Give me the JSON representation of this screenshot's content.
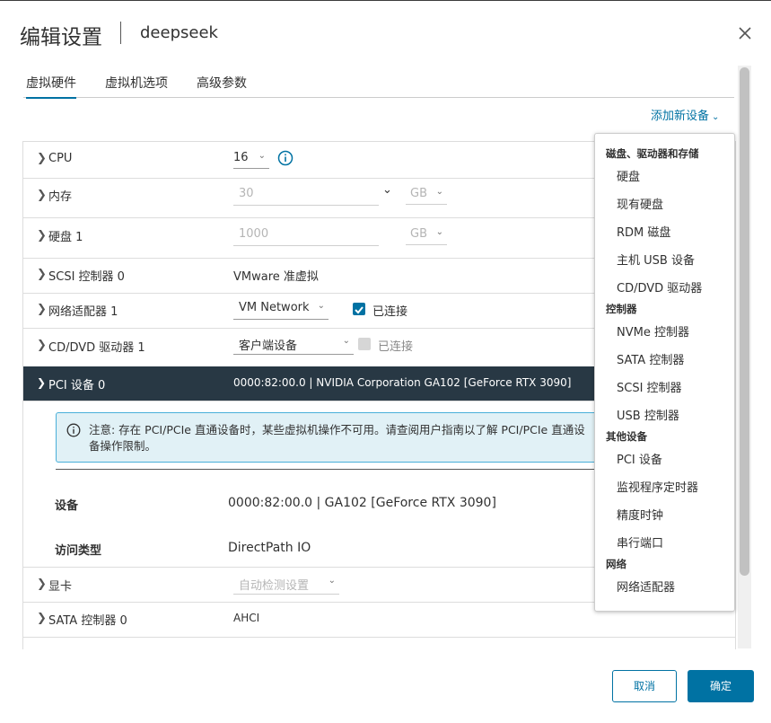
{
  "dialog": {
    "title": "编辑设置",
    "vm_name": "deepseek"
  },
  "tabs": [
    {
      "label": "虚拟硬件",
      "active": true
    },
    {
      "label": "虚拟机选项",
      "active": false
    },
    {
      "label": "高级参数",
      "active": false
    }
  ],
  "add_device": {
    "label": "添加新设备",
    "icon": "chevron-down-icon"
  },
  "hardware": {
    "cpu": {
      "label": "CPU",
      "value": "16"
    },
    "memory": {
      "label": "内存",
      "value": "30",
      "unit": "GB"
    },
    "disk": {
      "label": "硬盘 1",
      "value": "1000",
      "unit": "GB"
    },
    "scsi": {
      "label": "SCSI 控制器 0",
      "value": "VMware 准虚拟"
    },
    "nic": {
      "label": "网络适配器 1",
      "value": "VM Network",
      "connected_label": "已连接",
      "connected": true
    },
    "cdrom": {
      "label": "CD/DVD 驱动器 1",
      "value": "客户端设备",
      "connected_label": "已连接",
      "connected": false
    },
    "pci": {
      "label": "PCI 设备 0",
      "value": "0000:82:00.0 | NVIDIA Corporation GA102 [GeForce RTX 3090]",
      "alert_text": "注意: 存在 PCI/PCIe 直通设备时，某些虚拟机操作不可用。请查阅用户指南以了解 PCI/PCIe 直通设备操作限制。",
      "device_label": "设备",
      "device_value": "0000:82:00.0 | GA102 [GeForce RTX 3090]",
      "access_label": "访问类型",
      "access_value": "DirectPath IO"
    },
    "video": {
      "label": "显卡",
      "value": "自动检测设置"
    },
    "sata": {
      "label": "SATA 控制器 0",
      "value": "AHCI"
    }
  },
  "add_menu": {
    "sections": [
      {
        "title": "磁盘、驱动器和存储",
        "items": [
          "硬盘",
          "现有硬盘",
          "RDM 磁盘",
          "主机 USB 设备",
          "CD/DVD 驱动器"
        ]
      },
      {
        "title": "控制器",
        "items": [
          "NVMe 控制器",
          "SATA 控制器",
          "SCSI 控制器",
          "USB 控制器"
        ]
      },
      {
        "title": "其他设备",
        "items": [
          "PCI 设备",
          "监视程序定时器",
          "精度时钟",
          "串行端口"
        ]
      },
      {
        "title": "网络",
        "items": [
          "网络适配器"
        ]
      }
    ]
  },
  "footer": {
    "cancel": "取消",
    "ok": "确定"
  },
  "colors": {
    "accent": "#0072a3",
    "selected_row": "#283844",
    "info_bg": "#e1f1f6",
    "info_border": "#49afd9"
  }
}
